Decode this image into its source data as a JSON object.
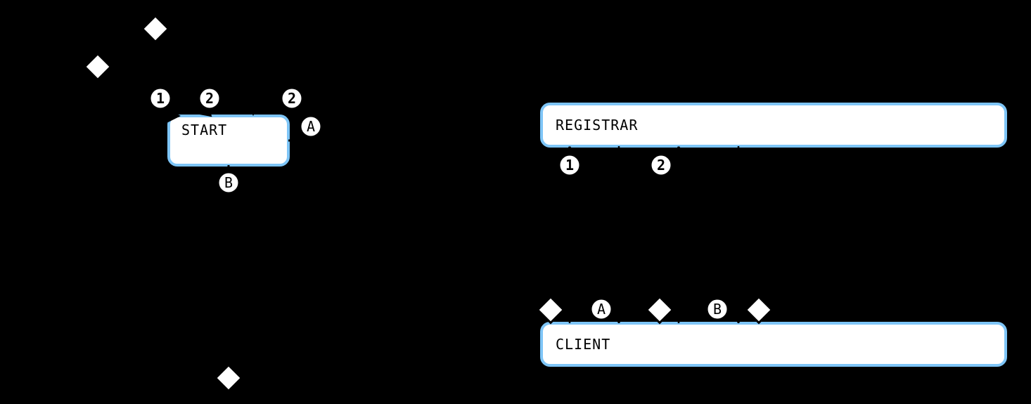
{
  "left_diagram": {
    "state_label": "START",
    "badges": {
      "in1": "1",
      "in2": "2",
      "loop": "2",
      "loop_letter": "A",
      "out_letter": "B"
    }
  },
  "right_diagram": {
    "top_label": "REGISTRAR",
    "bottom_label": "CLIENT",
    "badges": {
      "msg1": "1",
      "resp1": "A",
      "msg2": "2",
      "resp2": "B"
    }
  }
}
